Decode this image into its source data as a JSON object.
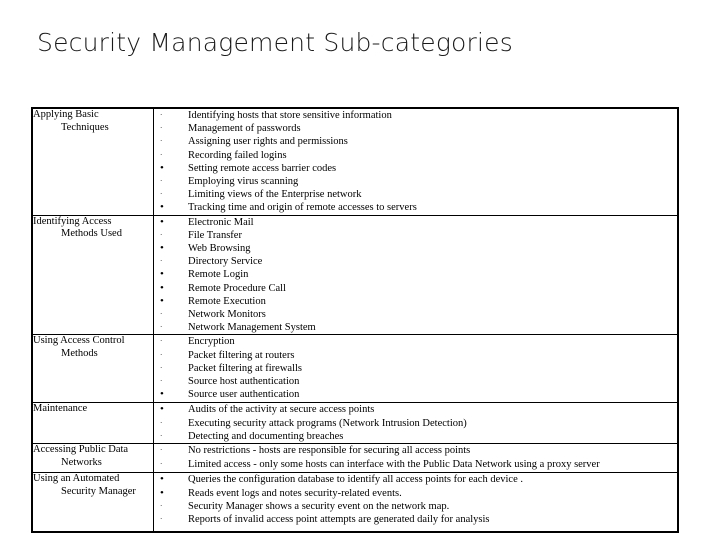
{
  "slide": {
    "title": "Security Management Sub-categories"
  },
  "table": {
    "rows": [
      {
        "category_line1": "Applying Basic",
        "category_line2": "Techniques",
        "items": [
          {
            "bullet": "small",
            "text": "Identifying hosts that store sensitive information"
          },
          {
            "bullet": "small",
            "text": "Management of passwords"
          },
          {
            "bullet": "small",
            "text": "Assigning user rights and permissions"
          },
          {
            "bullet": "small",
            "text": "Recording failed logins"
          },
          {
            "bullet": "large",
            "text": "Setting remote access barrier codes"
          },
          {
            "bullet": "small",
            "text": "Employing virus scanning"
          },
          {
            "bullet": "small",
            "text": "Limiting views of the Enterprise network"
          },
          {
            "bullet": "large",
            "text": "Tracking time and origin of remote accesses to servers"
          }
        ]
      },
      {
        "category_line1": "Identifying Access",
        "category_line2": "Methods Used",
        "items": [
          {
            "bullet": "large",
            "text": "Electronic Mail"
          },
          {
            "bullet": "small",
            "text": "File Transfer"
          },
          {
            "bullet": "large",
            "text": "Web Browsing"
          },
          {
            "bullet": "small",
            "text": "Directory Service"
          },
          {
            "bullet": "large",
            "text": "Remote Login"
          },
          {
            "bullet": "large",
            "text": "Remote Procedure Call"
          },
          {
            "bullet": "large",
            "text": "Remote Execution"
          },
          {
            "bullet": "small",
            "text": "Network Monitors"
          },
          {
            "bullet": "small",
            "text": "Network Management System"
          }
        ]
      },
      {
        "category_line1": "Using Access Control",
        "category_line2": "Methods",
        "items": [
          {
            "bullet": "small",
            "text": "Encryption"
          },
          {
            "bullet": "small",
            "text": "Packet filtering at routers"
          },
          {
            "bullet": "small",
            "text": "Packet filtering at firewalls"
          },
          {
            "bullet": "small",
            "text": "Source host authentication"
          },
          {
            "bullet": "large",
            "text": "Source user authentication"
          }
        ]
      },
      {
        "category_line1": "Maintenance",
        "category_line2": "",
        "items": [
          {
            "bullet": "large",
            "text": "Audits of the activity at secure access points"
          },
          {
            "bullet": "small",
            "text": "Executing security attack programs (Network Intrusion Detection)"
          },
          {
            "bullet": "small",
            "text": "Detecting and documenting breaches"
          }
        ]
      },
      {
        "category_line1": "Accessing Public Data",
        "category_line2": "Networks",
        "items": [
          {
            "bullet": "small",
            "text": "No restrictions - hosts are responsible for securing all access points"
          },
          {
            "bullet": "small",
            "text": "Limited access - only some hosts can interface with the Public Data Network using a proxy server"
          }
        ]
      },
      {
        "category_line1": "Using an Automated",
        "category_line2": "Security Manager",
        "items": [
          {
            "bullet": "large",
            "text": "Queries the configuration database to identify all access points for each device ."
          },
          {
            "bullet": "large",
            "text": "Reads  event logs and notes  security-related events."
          },
          {
            "bullet": "small",
            "text": "Security Manager shows a security event on the network map."
          },
          {
            "bullet": "small",
            "text": "Reports of  invalid access point attempts are generated daily for analysis"
          }
        ]
      }
    ]
  },
  "glyphs": {
    "bullet_small": "·",
    "bullet_large": "•"
  },
  "colors": {
    "page_background": "#ffffff",
    "text": "#000000",
    "title_text": "#1a1a1a",
    "table_border": "#000000"
  }
}
